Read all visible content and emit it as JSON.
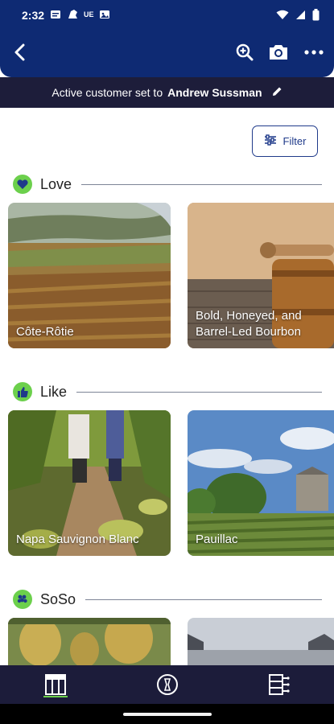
{
  "status_bar": {
    "time": "2:32",
    "left_icons": [
      "message-icon",
      "shield-icon",
      "ue-icon",
      "gallery-icon"
    ],
    "ue_text": "UE",
    "right_icons": [
      "wifi-icon",
      "signal-icon",
      "battery-icon"
    ]
  },
  "header": {
    "back_icon": "back-arrow-icon",
    "actions": [
      "zoom-in-icon",
      "camera-icon",
      "more-icon"
    ]
  },
  "banner": {
    "prefix": "Active customer set to",
    "customer": "Andrew Sussman"
  },
  "filter": {
    "label": "Filter",
    "icon": "sliders-icon"
  },
  "sections": [
    {
      "title": "Love",
      "badge_color": "#6cd04c",
      "cards": [
        {
          "label": "Côte-Rôtie"
        },
        {
          "label": "Bold, Honeyed, and Barrel-Led Bourbon"
        }
      ]
    },
    {
      "title": "Like",
      "badge_color": "#6cd04c",
      "cards": [
        {
          "label": "Napa Sauvignon Blanc"
        },
        {
          "label": "Pauillac"
        }
      ]
    },
    {
      "title": "SoSo",
      "badge_color": "#6cd04c",
      "cards": [
        {
          "label": ""
        },
        {
          "label": ""
        }
      ]
    }
  ],
  "bottom_nav": {
    "items": [
      "wine-list-icon",
      "compass-icon",
      "servers-icon"
    ],
    "active_index": 0
  },
  "colors": {
    "header": "#0e2a73",
    "banner": "#1d1d3a",
    "accent": "#6cd04c",
    "filter_border": "#1f3a8a",
    "bottom_nav": "#1c1c3a"
  }
}
